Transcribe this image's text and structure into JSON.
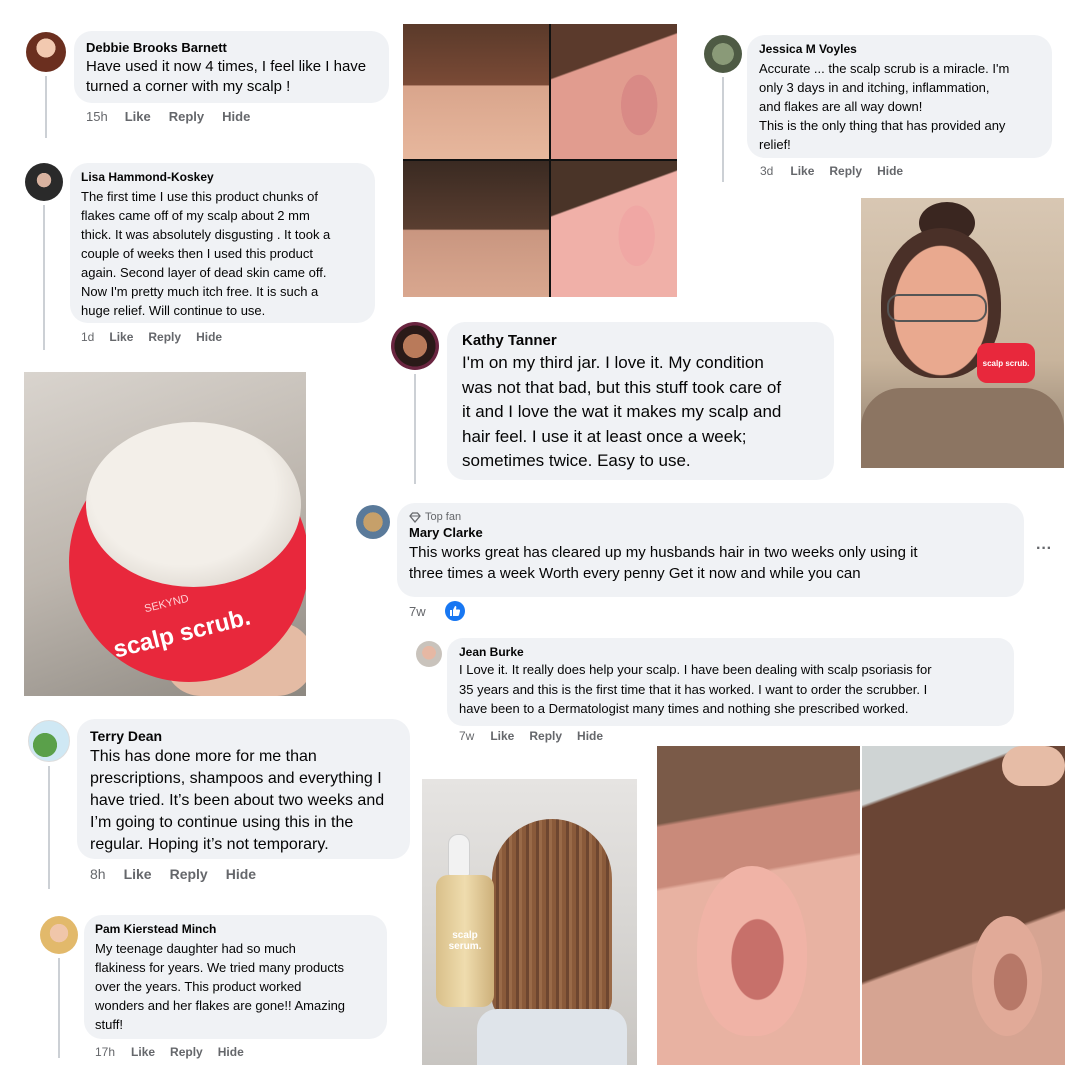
{
  "comments": {
    "debbie": {
      "name": "Debbie Brooks Barnett",
      "text": "Have used it now 4 times, I feel like I have\nturned a corner with my scalp !",
      "time": "15h",
      "like": "Like",
      "reply": "Reply",
      "hide": "Hide"
    },
    "lisa": {
      "name": "Lisa Hammond-Koskey",
      "text": "The first time I use this product chunks of\nflakes came off of my scalp about 2 mm\nthick. It was absolutely disgusting . It took a\ncouple of weeks then I used this product\nagain. Second layer of dead skin came off.\nNow I'm pretty much itch free. It is such a\nhuge relief. Will continue to use.",
      "time": "1d",
      "like": "Like",
      "reply": "Reply",
      "hide": "Hide"
    },
    "jessica": {
      "name": "Jessica M Voyles",
      "text": "Accurate ... the scalp scrub is a miracle. I'm\nonly 3 days in and itching, inflammation,\nand flakes are all way down!\nThis is the only thing that has provided any\nrelief!",
      "time": "3d",
      "like": "Like",
      "reply": "Reply",
      "hide": "Hide"
    },
    "kathy": {
      "name": "Kathy Tanner",
      "text": "I'm on my third jar. I love it. My condition\nwas not that bad, but this stuff took care of\nit and I love the wat it makes my scalp and\nhair feel. I use it at least once a week;\nsometimes twice. Easy to use."
    },
    "mary": {
      "badge": "Top fan",
      "name": "Mary Clarke",
      "text": "This works great has cleared up my husbands hair in two weeks only using it\nthree times a week Worth every penny Get it now and while you can",
      "time": "7w",
      "more": "···"
    },
    "jean": {
      "name": "Jean Burke",
      "text": "I Love it. It really does help your scalp. I have been dealing with scalp psoriasis for\n35 years and this is the first time that it has worked. I want to order the scrubber. I\nhave been to a Dermatologist many times and nothing she prescribed worked.",
      "time": "7w",
      "like": "Like",
      "reply": "Reply",
      "hide": "Hide"
    },
    "terry": {
      "name": "Terry Dean",
      "text": "This has done more for me than\nprescriptions, shampoos and everything I\nhave tried. It’s been about two weeks and\nI’m going to continue using this in the\nregular. Hoping it’s not temporary.",
      "time": "8h",
      "like": "Like",
      "reply": "Reply",
      "hide": "Hide"
    },
    "pam": {
      "name": "Pam Kierstead Minch",
      "text": "My teenage daughter had so much\nflakiness for years. We tried many products\nover the years. This product worked\nwonders and her flakes are gone!! Amazing\nstuff!",
      "time": "17h",
      "like": "Like",
      "reply": "Reply",
      "hide": "Hide"
    }
  },
  "products": {
    "scrub_brand": "SEKYND",
    "scrub_label": "scalp scrub.",
    "woman_jar_label": "scalp scrub.",
    "serum_label": "scalp serum."
  },
  "colors": {
    "bubble": "#f0f2f5",
    "meta": "#65676b",
    "like_blue": "#1877f2",
    "jar_red": "#e8283c"
  },
  "icons": {
    "top_fan": "diamond-icon",
    "reaction": "thumbs-up-icon",
    "more": "more-options-icon"
  }
}
